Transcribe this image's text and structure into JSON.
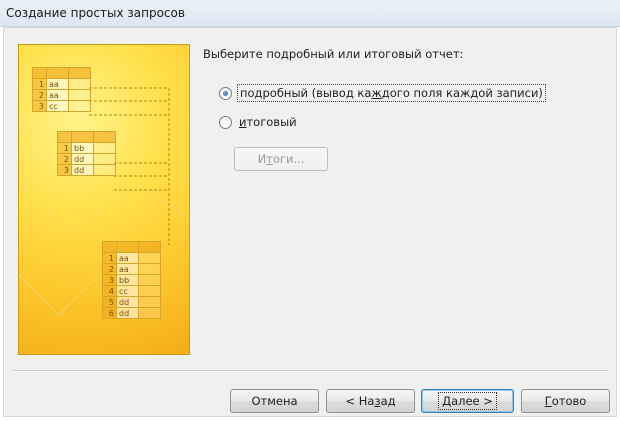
{
  "window": {
    "title": "Создание простых запросов"
  },
  "illustration": {
    "table1": {
      "rows": [
        [
          "1",
          "aa"
        ],
        [
          "2",
          "aa"
        ],
        [
          "3",
          "cc"
        ]
      ]
    },
    "table2": {
      "rows": [
        [
          "1",
          "bb"
        ],
        [
          "2",
          "dd"
        ],
        [
          "3",
          "dd"
        ]
      ]
    },
    "table3": {
      "rows": [
        [
          "1",
          "aa"
        ],
        [
          "2",
          "aa"
        ],
        [
          "3",
          "bb"
        ],
        [
          "4",
          "cc"
        ],
        [
          "5",
          "dd"
        ],
        [
          "6",
          "dd"
        ]
      ]
    }
  },
  "prompt": "Выберите подробный или итоговый отчет:",
  "options": {
    "detail": {
      "pre": "подробный (вывод ка",
      "ul": "ж",
      "post": "дого поля каждой записи)",
      "checked": true
    },
    "summary": {
      "pre": "",
      "ul": "и",
      "post": "тоговый",
      "checked": false
    }
  },
  "summary_button": {
    "pre": "И",
    "ul": "т",
    "post": "оги...",
    "enabled": false
  },
  "buttons": {
    "cancel": {
      "pre": "Отмена",
      "ul": "",
      "post": ""
    },
    "back": {
      "pre": "< На",
      "ul": "з",
      "post": "ад"
    },
    "next": {
      "pre": "",
      "ul": "Д",
      "post": "алее >"
    },
    "finish": {
      "pre": "",
      "ul": "Г",
      "post": "отово"
    }
  }
}
